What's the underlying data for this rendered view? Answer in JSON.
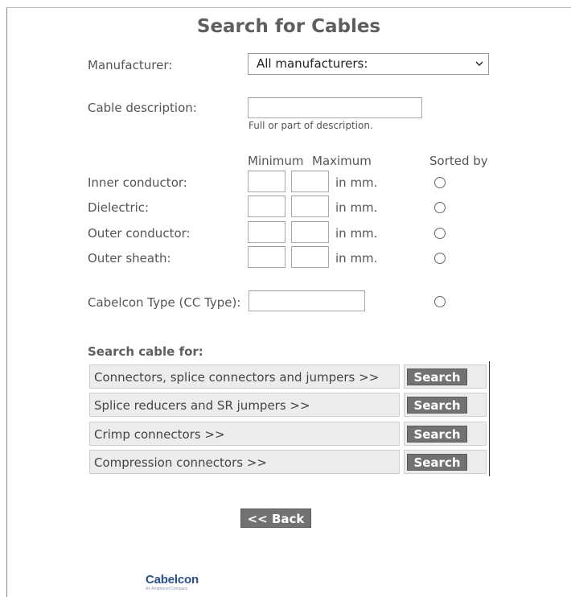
{
  "page": {
    "title": "Search for Cables"
  },
  "form": {
    "manufacturer_label": "Manufacturer:",
    "manufacturer_selected": "All manufacturers:",
    "description_label": "Cable description:",
    "description_value": "",
    "description_hint": "Full or part of description.",
    "col_minimum": "Minimum",
    "col_maximum": "Maximum",
    "col_sorted_by": "Sorted by",
    "unit": "in mm.",
    "dimensions": [
      {
        "label": "Inner conductor:",
        "min": "",
        "max": "",
        "sorted": false
      },
      {
        "label": "Dielectric:",
        "min": "",
        "max": "",
        "sorted": false
      },
      {
        "label": "Outer conductor:",
        "min": "",
        "max": "",
        "sorted": false
      },
      {
        "label": "Outer sheath:",
        "min": "",
        "max": "",
        "sorted": false
      }
    ],
    "cc_type_label": "Cabelcon Type (CC Type):",
    "cc_type_value": "",
    "cc_type_sorted": false
  },
  "search_for": {
    "heading": "Search cable for:",
    "rows": [
      {
        "label": "Connectors, splice connectors and jumpers >>",
        "button": "Search"
      },
      {
        "label": "Splice reducers and SR jumpers >>",
        "button": "Search"
      },
      {
        "label": "Crimp connectors >>",
        "button": "Search"
      },
      {
        "label": "Compression connectors >>",
        "button": "Search"
      }
    ]
  },
  "back_button": "<< Back",
  "logo": {
    "brand": "Cabelcon",
    "tagline": "An Amphenol Company"
  },
  "colors": {
    "button_bg": "#727272",
    "row_bg": "#ececec",
    "logo_blue": "#2c4f8a",
    "text": "#555555"
  },
  "icons": {
    "select_arrow": "chevron-down-icon",
    "sort_radio": "radio-icon"
  }
}
